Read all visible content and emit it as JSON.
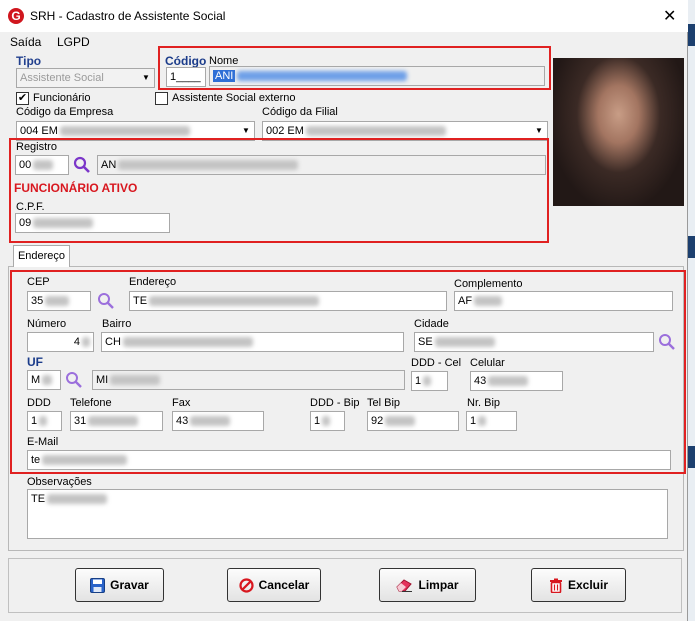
{
  "window": {
    "title": "SRH - Cadastro de Assistente Social",
    "app_icon_letter": "G",
    "close_glyph": "✕"
  },
  "menu": [
    "Saída",
    "LGPD"
  ],
  "header": {
    "tipo_label": "Tipo",
    "tipo_value": "Assistente Social",
    "codigo_label": "Código",
    "codigo_value": "1____",
    "nome_label": "Nome",
    "nome_value": "ANI",
    "funcionario_label": "Funcionário",
    "funcionario_checked": true,
    "externo_label": "Assistente Social externo",
    "externo_checked": false,
    "empresa_label": "Código da Empresa",
    "empresa_value": "004 EM",
    "filial_label": "Código da Filial",
    "filial_value": "002 EM"
  },
  "registro": {
    "label": "Registro",
    "code": "00",
    "name": "AN",
    "status": "FUNCIONÁRIO ATIVO",
    "cpf_label": "C.P.F.",
    "cpf_value": "09"
  },
  "tabs": [
    "Endereço"
  ],
  "endereco": {
    "cep_label": "CEP",
    "cep_value": "35",
    "endereco_label": "Endereço",
    "endereco_value": "TE",
    "complemento_label": "Complemento",
    "complemento_value": "AF",
    "numero_label": "Número",
    "numero_value": "4",
    "bairro_label": "Bairro",
    "bairro_value": "CH",
    "cidade_label": "Cidade",
    "cidade_value": "SE",
    "uf_label": "UF",
    "uf_code": "M",
    "uf_name": "MI",
    "ddd_cel_label": "DDD - Cel",
    "ddd_cel_value": "1",
    "celular_label": "Celular",
    "celular_value": "43",
    "ddd_label": "DDD",
    "ddd_value": "1",
    "telefone_label": "Telefone",
    "telefone_value": "31",
    "fax_label": "Fax",
    "fax_value": "43",
    "ddd_bip_label": "DDD - Bip",
    "ddd_bip_value": "1",
    "tel_bip_label": "Tel Bip",
    "tel_bip_value": "92",
    "nr_bip_label": "Nr. Bip",
    "nr_bip_value": "1",
    "email_label": "E-Mail",
    "email_value": "te"
  },
  "observacoes": {
    "label": "Observações",
    "value": "TE"
  },
  "buttons": {
    "gravar": "Gravar",
    "cancelar": "Cancelar",
    "limpar": "Limpar",
    "excluir": "Excluir"
  },
  "colors": {
    "highlight_border": "#e02121",
    "status_text": "#d8171f",
    "label_blue": "#22408e",
    "search_icon": "#7b36c9"
  }
}
